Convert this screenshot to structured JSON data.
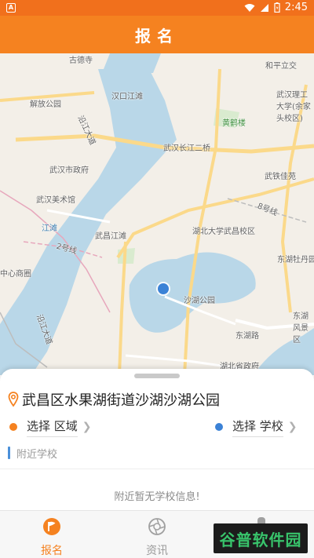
{
  "status_bar": {
    "time": "2:45",
    "notification_icon": "A"
  },
  "header": {
    "title": "报名"
  },
  "map": {
    "labels": [
      {
        "text": "和平立交",
        "color": "gray"
      },
      {
        "text": "汉口江滩",
        "color": "gray"
      },
      {
        "text": "武汉理工大学(余家头校区)",
        "color": "gray"
      },
      {
        "text": "解放公园",
        "color": "gray"
      },
      {
        "text": "沿江大道",
        "color": "gray"
      },
      {
        "text": "黄鹤楼",
        "color": "green"
      },
      {
        "text": "武汉长江二桥",
        "color": "gray"
      },
      {
        "text": "武汉市政府",
        "color": "gray"
      },
      {
        "text": "武铁佳苑",
        "color": "gray"
      },
      {
        "text": "武汉美术馆",
        "color": "gray"
      },
      {
        "text": "8号线",
        "color": "gray"
      },
      {
        "text": "江滩",
        "color": "blue"
      },
      {
        "text": "武昌江滩",
        "color": "gray"
      },
      {
        "text": "湖北大学武昌校区",
        "color": "gray"
      },
      {
        "text": "2号线",
        "color": "gray"
      },
      {
        "text": "东湖牡丹园",
        "color": "gray"
      },
      {
        "text": "中心商圈",
        "color": "gray"
      },
      {
        "text": "沙湖公园",
        "color": "gray"
      },
      {
        "text": "沿江大道",
        "color": "gray"
      },
      {
        "text": "东湖路",
        "color": "gray"
      },
      {
        "text": "东湖风景区",
        "color": "gray"
      },
      {
        "text": "湖北省政府",
        "color": "gray"
      },
      {
        "text": "古德寺",
        "color": "gray"
      }
    ]
  },
  "panel": {
    "address": "武昌区水果湖街道沙湖沙湖公园",
    "region_select": {
      "label": "选择 区域",
      "dot_color": "#f58220"
    },
    "school_select": {
      "label": "选择 学校",
      "dot_color": "#3b82d6"
    },
    "nearby_header": "附近学校",
    "empty_message": "附近暂无学校信息!"
  },
  "tabs": [
    {
      "label": "报名",
      "icon": "flag-icon",
      "active": true
    },
    {
      "label": "资讯",
      "icon": "camera-shutter-icon",
      "active": false
    }
  ],
  "watermark": {
    "text": "谷普软件园"
  },
  "colors": {
    "accent": "#f58220",
    "status_bar": "#f1701c",
    "location_dot": "#3b82d6"
  }
}
